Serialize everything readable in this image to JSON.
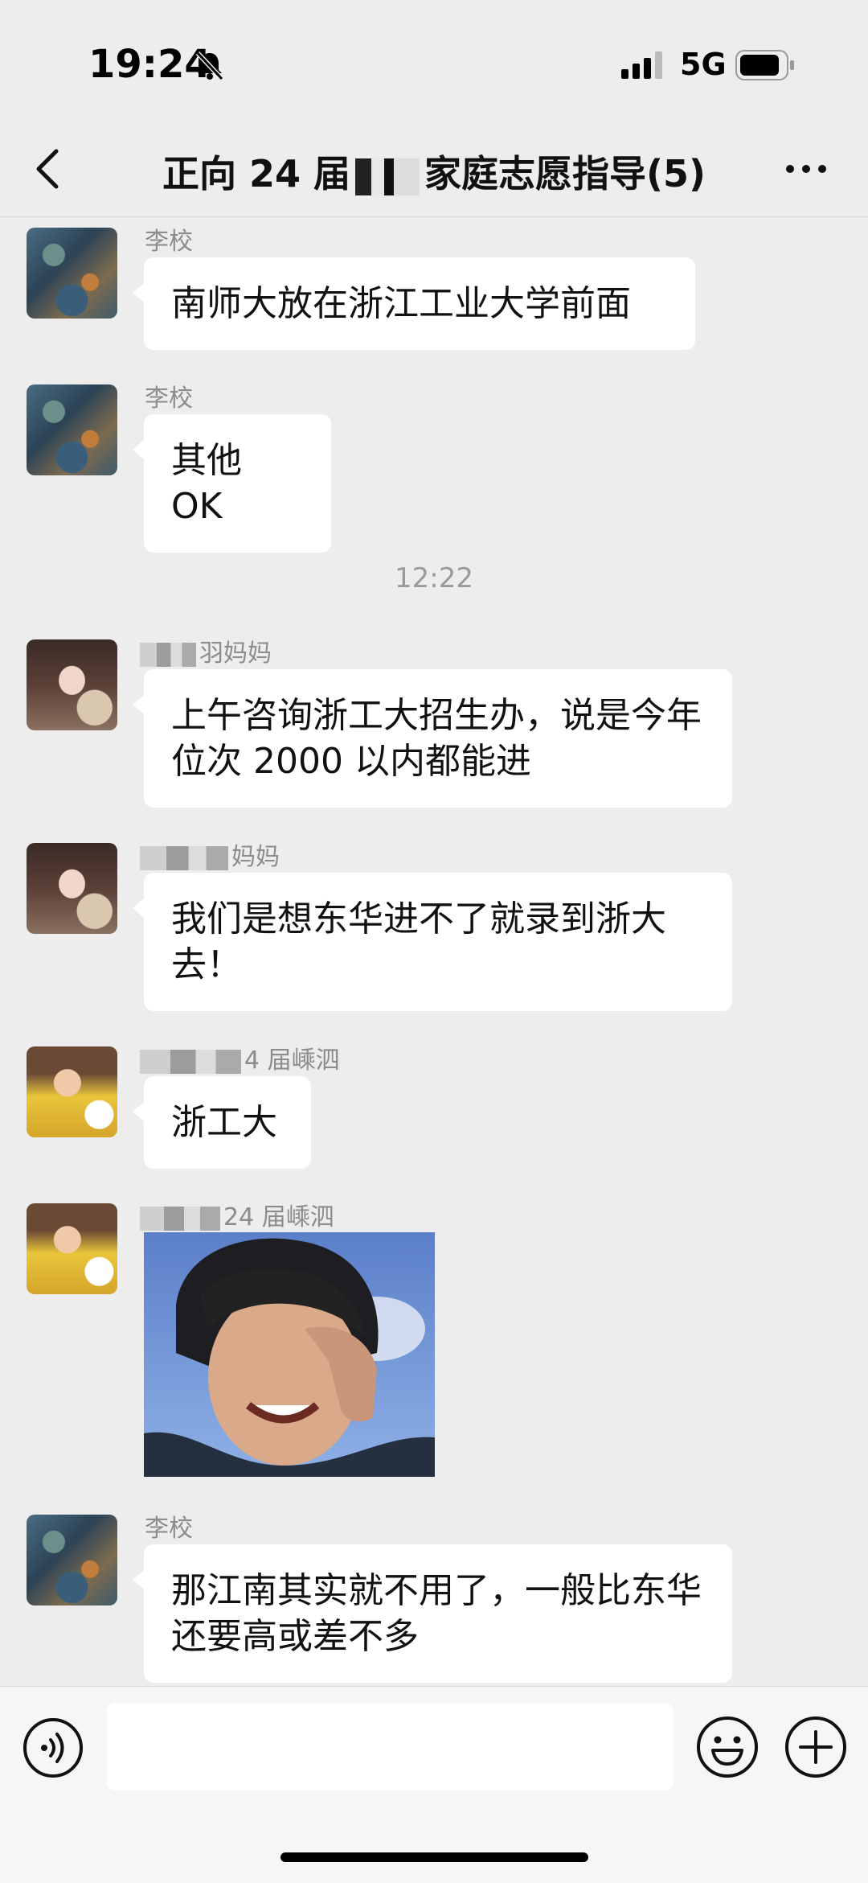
{
  "status_bar": {
    "time": "19:24",
    "network": "5G",
    "icons": [
      "bell-muted-icon",
      "signal-icon",
      "battery-icon"
    ]
  },
  "nav": {
    "title_prefix": "正向 24 届",
    "title_suffix": "家庭志愿指导(5)",
    "back_icon": "chevron-left-icon",
    "more_icon": "more-horizontal-icon"
  },
  "messages": [
    {
      "sender": "李校",
      "text": "南师大放在浙江工业大学前面",
      "avatar": "painting"
    },
    {
      "sender": "李校",
      "text": "其他 OK",
      "avatar": "painting"
    },
    {
      "timestamp": "12:22"
    },
    {
      "sender": "羽妈妈",
      "text": "上午咨询浙工大招生办，说是今年位次 2000 以内都能进",
      "avatar": "girl"
    },
    {
      "sender": "妈妈",
      "text": "我们是想东华进不了就录到浙大去！",
      "avatar": "girl"
    },
    {
      "sender": "4 届嵊泗",
      "text": "浙工大",
      "avatar": "kid"
    },
    {
      "sender": "24 届嵊泗",
      "sticker": "laughing-person-sticker",
      "avatar": "kid"
    },
    {
      "sender": "李校",
      "text": "那江南其实就不用了，一般比东华还要高或差不多",
      "avatar": "painting"
    }
  ],
  "input_bar": {
    "message_value": "",
    "icons": [
      "voice-icon",
      "emoji-icon",
      "plus-icon"
    ]
  },
  "colors": {
    "background": "#ededed",
    "bubble": "#ffffff",
    "sender_text": "#8c8c8c"
  }
}
